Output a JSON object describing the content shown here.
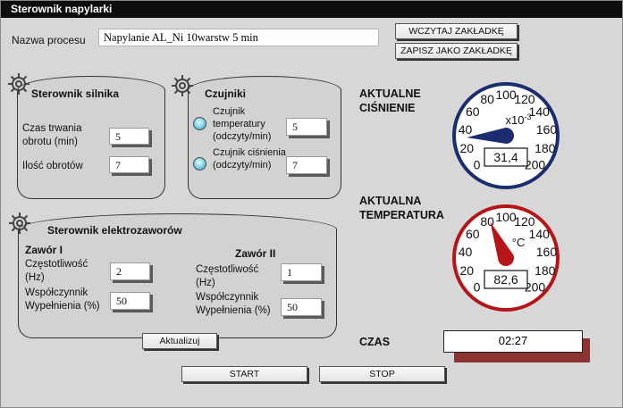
{
  "window": {
    "title": "Sterownik napylarki"
  },
  "process": {
    "label": "Nazwa procesu",
    "value": "Napylanie AL_Ni 10warstw 5 min"
  },
  "buttons": {
    "load": "WCZYTAJ ZAKŁADKĘ",
    "save_as": "ZAPISZ JAKO ZAKŁADKĘ",
    "update": "Aktualizuj",
    "start": "START",
    "stop": "STOP"
  },
  "motor": {
    "title": "Sterownik silnika",
    "duration_label": "Czas trwania obrotu  (min)",
    "duration_value": "5",
    "count_label": "Ilość obrotów",
    "count_value": "7"
  },
  "sensors": {
    "title": "Czujniki",
    "temp_label": "Czujnik temperatury (odczyty/min)",
    "temp_value": "5",
    "pressure_label": "Czujnik ciśnienia (odczyty/min)",
    "pressure_value": "7"
  },
  "valves": {
    "title": "Sterownik elektrozaworów",
    "valve1": {
      "title": "Zawór I",
      "freq_label": "Częstotliwość (Hz)",
      "freq_value": "2",
      "fill_label": "Współczynnik Wypełnienia  (%)",
      "fill_value": "50"
    },
    "valve2": {
      "title": "Zawór II",
      "freq_label": "Częstotliwość (Hz)",
      "freq_value": "1",
      "fill_label": "Współczynnik Wypełnienia  (%)",
      "fill_value": "50"
    }
  },
  "pressure": {
    "label": "AKTUALNE CIŚNIENIE",
    "unit": "x10-3",
    "value": "31,4",
    "reading": 31.4,
    "scale_min": 0,
    "scale_max": 200,
    "ticks": [
      "0",
      "20",
      "40",
      "60",
      "80",
      "100",
      "120",
      "140",
      "160",
      "180",
      "200"
    ],
    "color": "#1a2d6e"
  },
  "temperature": {
    "label": "AKTUALNA TEMPERATURA",
    "unit": "°C",
    "value": "82,6",
    "reading": 82.6,
    "scale_min": 0,
    "scale_max": 200,
    "ticks": [
      "0",
      "20",
      "40",
      "60",
      "80",
      "100",
      "120",
      "140",
      "160",
      "180",
      "200"
    ],
    "color": "#b51418"
  },
  "time": {
    "label": "CZAS",
    "value": "02:27"
  }
}
